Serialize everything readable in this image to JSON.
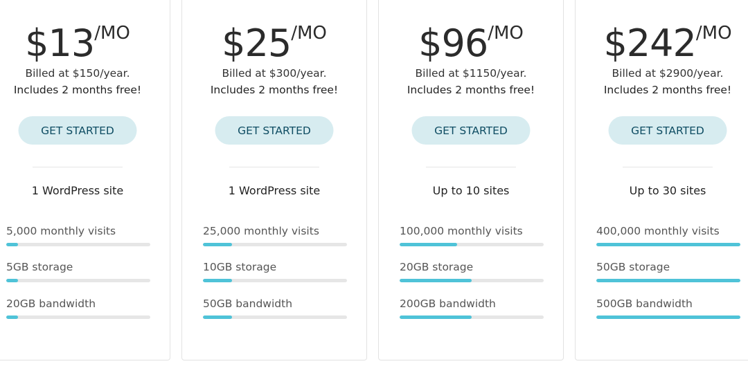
{
  "plans": [
    {
      "price": "$13",
      "per": "/MO",
      "billed": "Billed at $150/year.",
      "free": "Includes 2 months free!",
      "button": "GET STARTED",
      "sites": "1 WordPress site",
      "features": [
        {
          "label": "5,000 monthly visits",
          "fill": 0.08
        },
        {
          "label": "5GB storage",
          "fill": 0.08
        },
        {
          "label": "20GB bandwidth",
          "fill": 0.08
        }
      ]
    },
    {
      "price": "$25",
      "per": "/MO",
      "billed": "Billed at $300/year.",
      "free": "Includes 2 months free!",
      "button": "GET STARTED",
      "sites": "1 WordPress site",
      "features": [
        {
          "label": "25,000 monthly visits",
          "fill": 0.2
        },
        {
          "label": "10GB storage",
          "fill": 0.2
        },
        {
          "label": "50GB bandwidth",
          "fill": 0.2
        }
      ]
    },
    {
      "price": "$96",
      "per": "/MO",
      "billed": "Billed at $1150/year.",
      "free": "Includes 2 months free!",
      "button": "GET STARTED",
      "sites": "Up to 10 sites",
      "features": [
        {
          "label": "100,000 monthly visits",
          "fill": 0.4
        },
        {
          "label": "20GB storage",
          "fill": 0.5
        },
        {
          "label": "200GB bandwidth",
          "fill": 0.5
        }
      ]
    },
    {
      "price": "$242",
      "per": "/MO",
      "billed": "Billed at $2900/year.",
      "free": "Includes 2 months free!",
      "button": "GET STARTED",
      "sites": "Up to 30 sites",
      "features": [
        {
          "label": "400,000 monthly visits",
          "fill": 1.0
        },
        {
          "label": "50GB storage",
          "fill": 1.0
        },
        {
          "label": "500GB bandwidth",
          "fill": 1.0
        }
      ]
    }
  ]
}
